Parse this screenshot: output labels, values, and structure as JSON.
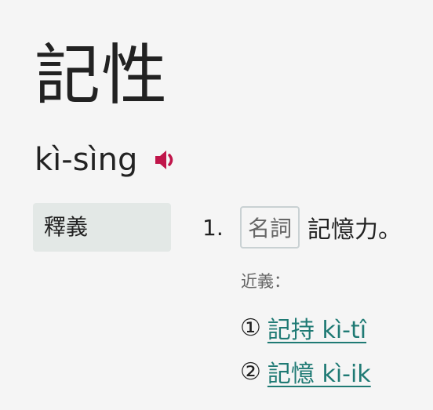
{
  "entry": {
    "headword": "記性",
    "romanization": "kì-sìng"
  },
  "section_label": "釋義",
  "definition": {
    "number": "1.",
    "part_of_speech": "名詞",
    "text": "記憶力。"
  },
  "synonyms": {
    "label": "近義：",
    "items": [
      {
        "marker": "①",
        "text": "記持 kì-tî"
      },
      {
        "marker": "②",
        "text": "記憶 kì-ik"
      }
    ]
  },
  "icons": {
    "speaker": "speaker-icon"
  },
  "colors": {
    "link": "#1f7a74",
    "speaker": "#c0154a",
    "section_bg": "#e3e8e6"
  }
}
